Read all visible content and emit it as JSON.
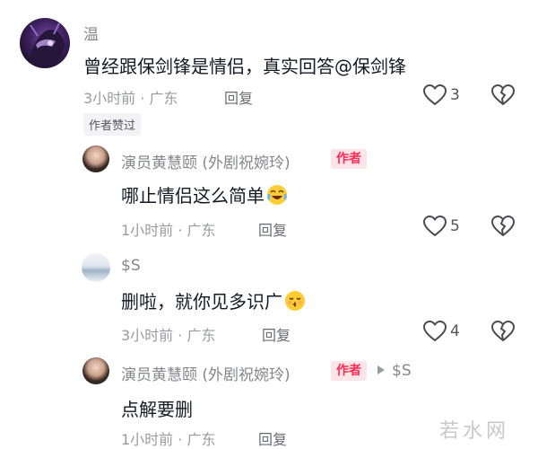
{
  "comment1": {
    "username": "温",
    "text": "曾经跟保剑锋是情侣，真实回答@保剑锋",
    "meta": "3小时前 · 广东",
    "reply_label": "回复",
    "like_count": "3",
    "liked_badge": "作者赞过"
  },
  "reply1": {
    "username": "演员黄慧颐 (外剧祝婉玲)",
    "author_badge": "作者",
    "text": "哪止情侣这么简单",
    "meta": "1小时前 · 广东",
    "reply_label": "回复",
    "like_count": "5"
  },
  "reply2": {
    "username": "$S",
    "text": "删啦，就你见多识广",
    "meta": "3小时前 · 广东",
    "reply_label": "回复",
    "like_count": "4"
  },
  "reply3": {
    "username": "演员黄慧颐 (外剧祝婉玲)",
    "author_badge": "作者",
    "reply_to": "$S",
    "text": "点解要删",
    "meta": "1小时前 · 广东",
    "reply_label": "回复"
  },
  "watermark": "若水网",
  "icons": {
    "like": "heart-outline-icon",
    "dislike": "broken-heart-icon",
    "reply_arrow": "triangle-right-icon"
  }
}
